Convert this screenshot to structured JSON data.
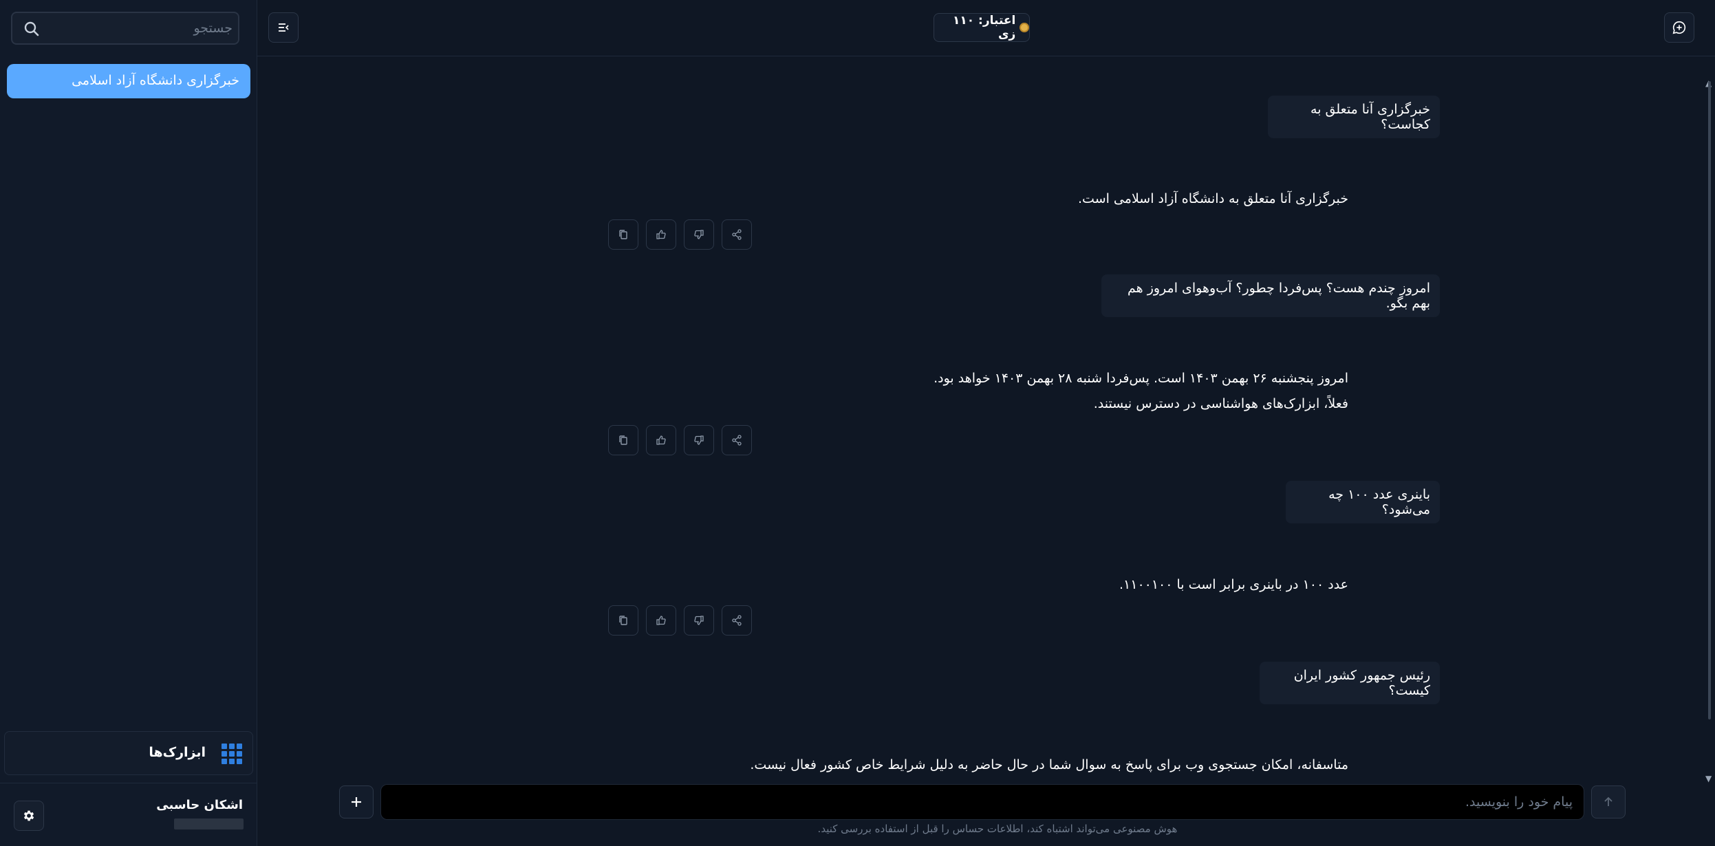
{
  "sidebar": {
    "search_placeholder": "جستجو",
    "conversations": [
      {
        "title": "خبرگزاری دانشگاه آزاد اسلامی"
      }
    ],
    "tools_label": "ابزارک‌ها",
    "user_name": "اشکان حاسبی"
  },
  "header": {
    "credit_label": "اعتبار: ۱۱۰ زی"
  },
  "messages": [
    {
      "role": "user",
      "text": "خبرگزاری آنا متعلق به کجاست؟"
    },
    {
      "role": "assistant",
      "lines": [
        "خبرگزاری آنا متعلق به دانشگاه آزاد اسلامی است."
      ]
    },
    {
      "role": "user",
      "text": "امروز چندم هست؟ پس‌فردا چطور؟ آب‌وهوای امروز هم بهم بگو."
    },
    {
      "role": "assistant",
      "lines": [
        "امروز پنجشنبه ۲۶ بهمن ۱۴۰۳ است. پس‌فردا شنبه ۲۸ بهمن ۱۴۰۳ خواهد بود.",
        "فعلاً، ابزارک‌های هواشناسی در دسترس نیستند."
      ]
    },
    {
      "role": "user",
      "text": "باینری عدد ۱۰۰ چه می‌شود؟"
    },
    {
      "role": "assistant",
      "lines": [
        "عدد ۱۰۰ در باینری برابر است با ۱۱۰۰۱۰۰."
      ]
    },
    {
      "role": "user",
      "text": "رئیس جمهور کشور ایران کیست؟"
    },
    {
      "role": "assistant",
      "lines": [
        "متاسفانه، امکان جستجوی وب برای پاسخ به سوال شما در حال حاضر به دلیل شرایط خاص کشور فعال نیست."
      ]
    }
  ],
  "composer": {
    "placeholder": "پیام خود را بنویسید.",
    "disclaimer": "هوش مصنوعی می‌تواند اشتباه کند، اطلاعات حساس را قبل از استفاده بررسی کنید."
  },
  "colors": {
    "background": "#0f1724",
    "accent": "#5aa9ff",
    "tools_icon": "#2f7fe0",
    "coin": "#e3b24a"
  }
}
